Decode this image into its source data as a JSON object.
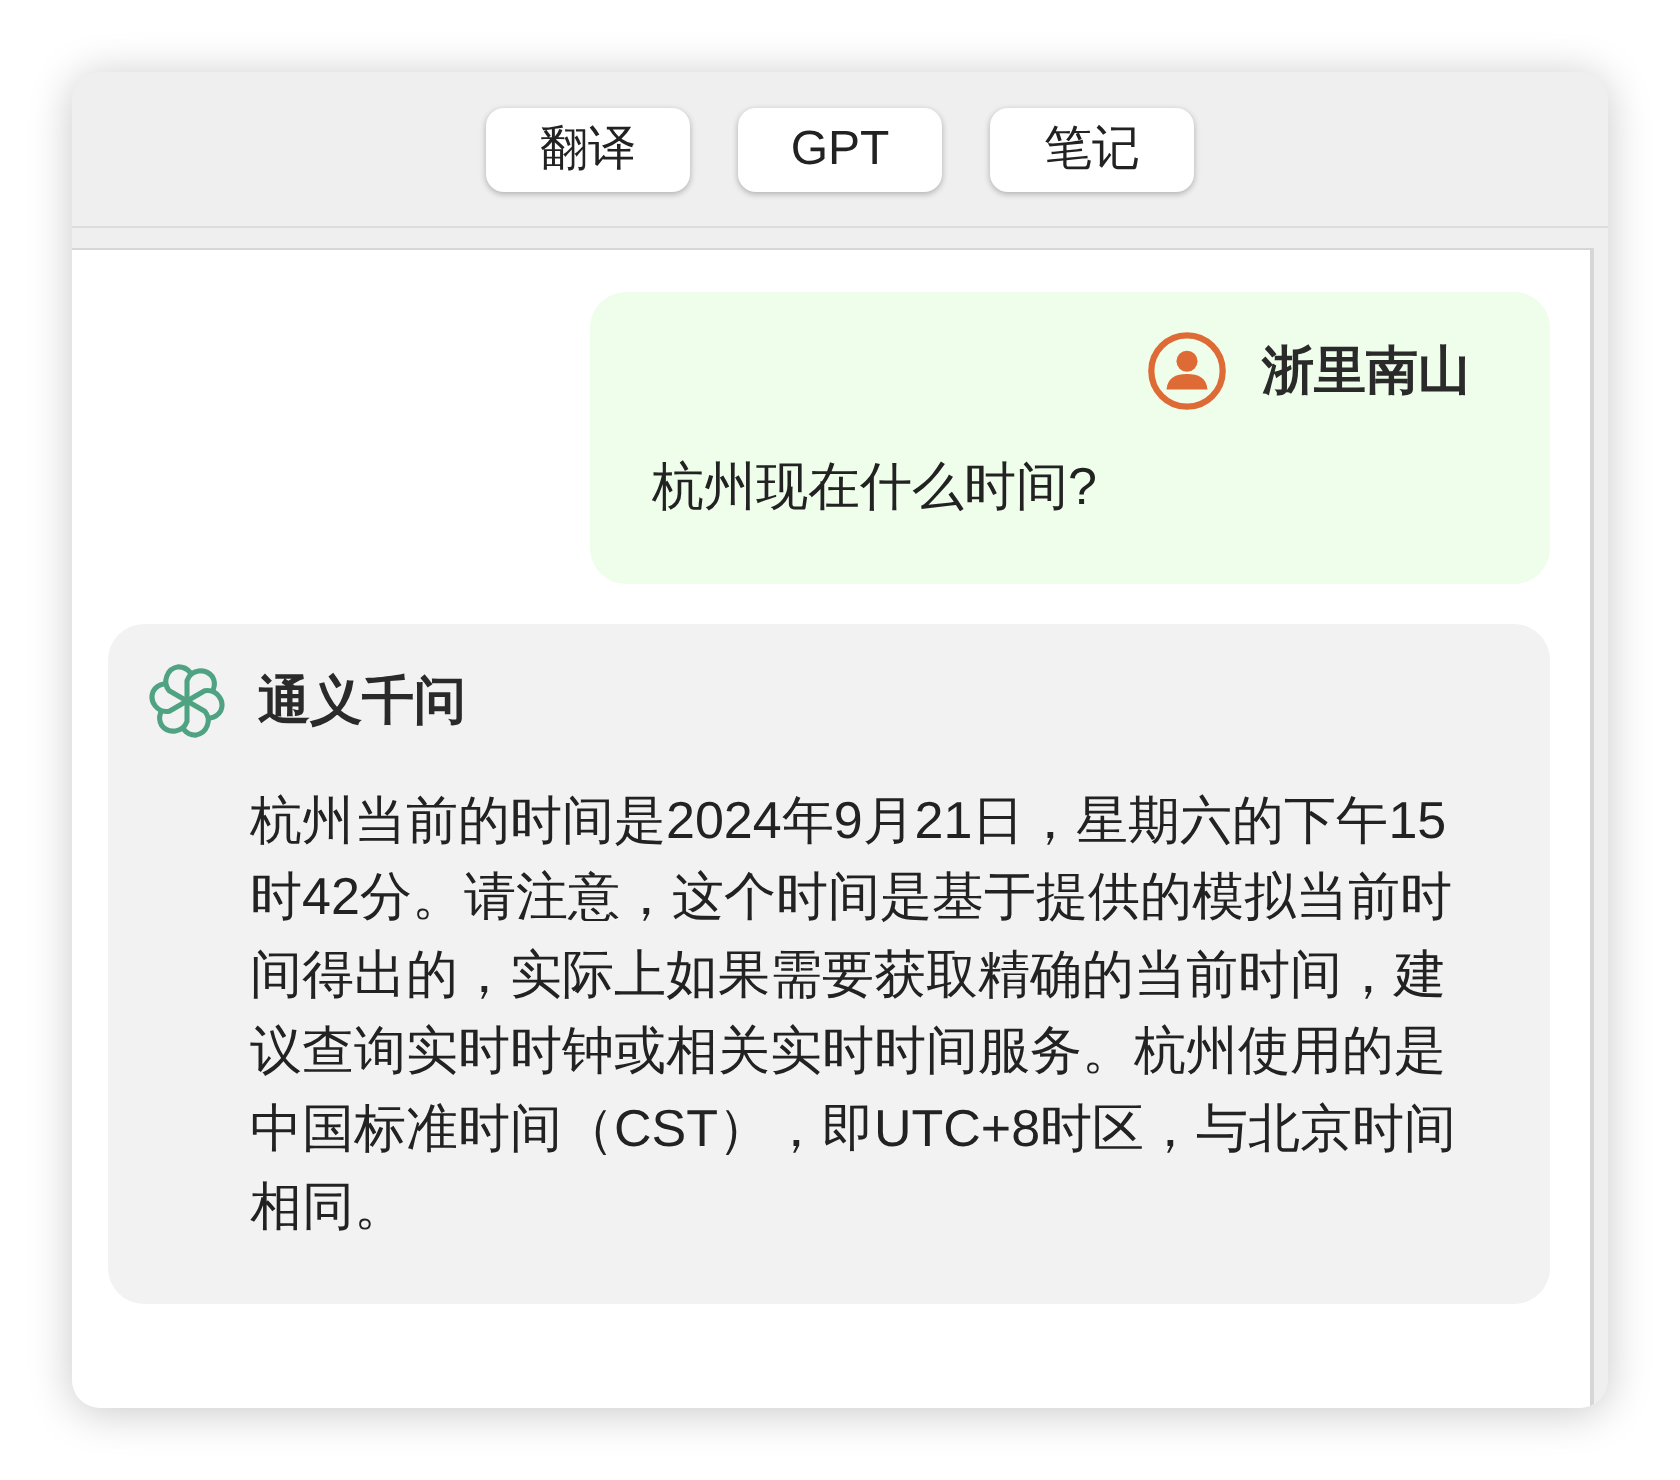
{
  "toolbar": {
    "buttons": [
      {
        "label": "翻译"
      },
      {
        "label": "GPT"
      },
      {
        "label": "笔记"
      }
    ]
  },
  "messages": [
    {
      "kind": "user",
      "sender": "浙里南山",
      "text": "杭州现在什么时间?"
    },
    {
      "kind": "assistant",
      "sender": "通义千问",
      "text": "杭州当前的时间是2024年9月21日，星期六的下午15时42分。请注意，这个时间是基于提供的模拟当前时间得出的，实际上如果需要获取精确的当前时间，建议查询实时时钟或相关实时时间服务。杭州使用的是中国标准时间（CST），即UTC+8时区，与北京时间相同。"
    }
  ]
}
